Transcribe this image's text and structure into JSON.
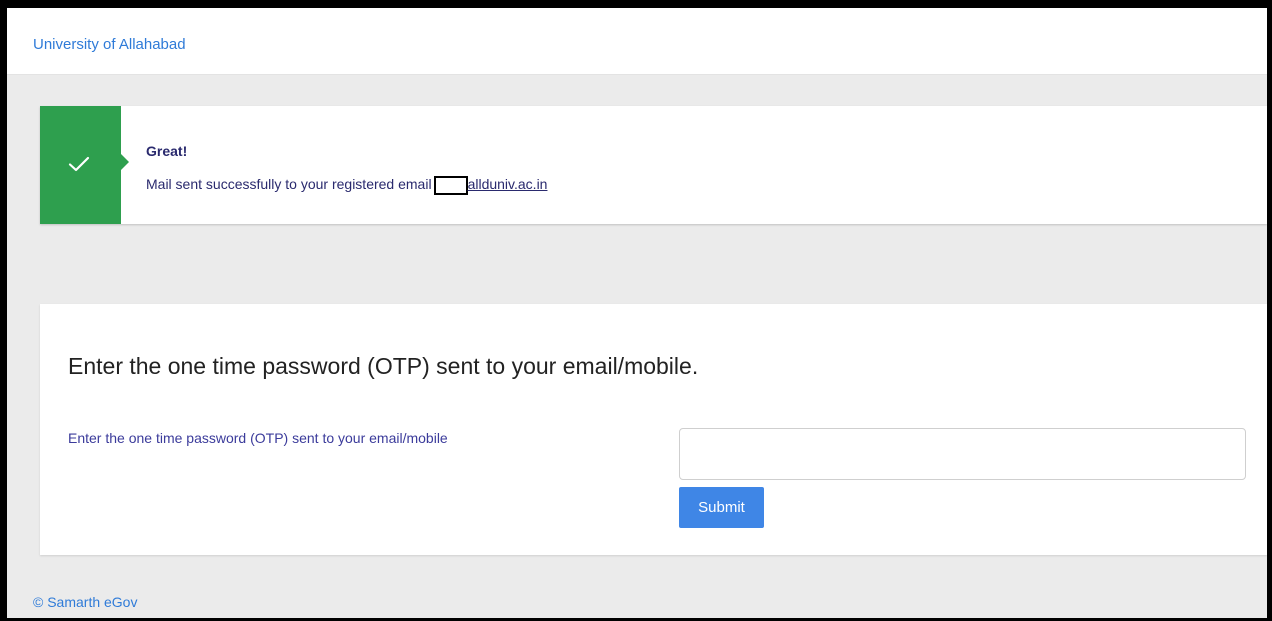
{
  "header": {
    "brand": "University of Allahabad"
  },
  "alert": {
    "title": "Great!",
    "message_prefix": "Mail sent successfully to your registered email",
    "email_visible_part": "allduniv.ac.in",
    "icon": "check-icon",
    "color": "#2e9f4e"
  },
  "otp_form": {
    "heading": "Enter the one time password (OTP) sent to your email/mobile.",
    "label": "Enter the one time password (OTP) sent to your email/mobile",
    "input_value": "",
    "submit_label": "Submit"
  },
  "footer": {
    "copyright": "© Samarth eGov"
  }
}
